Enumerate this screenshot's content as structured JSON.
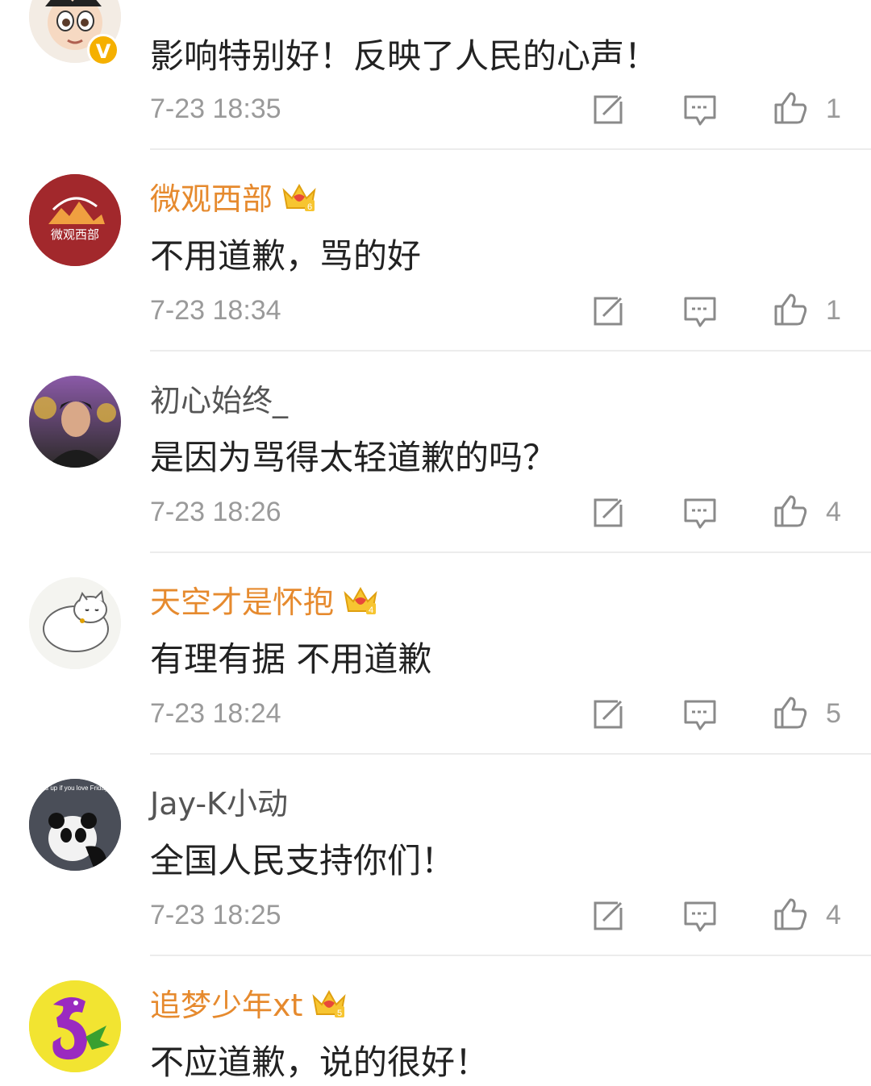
{
  "comments": [
    {
      "name": "",
      "vip": false,
      "verified": true,
      "text": "影响特别好！反映了人民的心声！",
      "time": "7-23 18:35",
      "likes": "1",
      "avatar": "astro-boy-avatar"
    },
    {
      "name": "微观西部",
      "vip": true,
      "vip_level": "6",
      "text": "不用道歉，骂的好",
      "time": "7-23 18:34",
      "likes": "1",
      "avatar": "weiguan-xibu-logo",
      "avatar_text": "微观西部"
    },
    {
      "name": "初心始终_",
      "vip": false,
      "text": "是因为骂得太轻道歉的吗？",
      "time": "7-23 18:26",
      "likes": "4",
      "avatar": "portrait-photo"
    },
    {
      "name": "天空才是怀抱",
      "vip": true,
      "vip_level": "4",
      "text": "有理有据 不用道歉",
      "time": "7-23 18:24",
      "likes": "5",
      "avatar": "cat-drawing"
    },
    {
      "name": "Jay-K小动",
      "vip": false,
      "text": "全国人民支持你们！",
      "time": "7-23 18:25",
      "likes": "4",
      "avatar": "panda-photo",
      "avatar_caption": "hands up if you love Fridays :-)"
    },
    {
      "name": "追梦少年xt",
      "vip": true,
      "vip_level": "5",
      "text": "不应道歉，说的很好！",
      "avatar": "purple-dinosaur"
    }
  ],
  "icons": {
    "repost": "repost-icon",
    "comment": "comment-icon",
    "like": "thumbs-up-icon",
    "crown": "vip-crown-icon"
  },
  "colors": {
    "vip_name": "#e68a2e",
    "plain_name": "#555555",
    "meta": "#9a9a9a",
    "divider": "#ececec"
  }
}
